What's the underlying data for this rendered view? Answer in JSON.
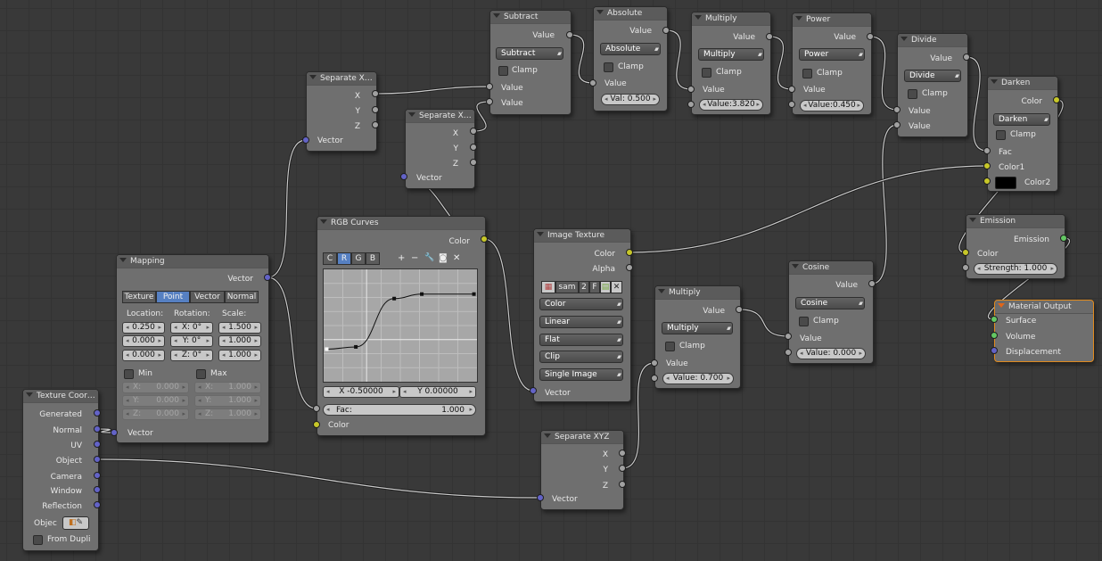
{
  "colors": {
    "canvas": "#393939",
    "node_body": "#6f6f6f",
    "socket_value": "#a1a1a1",
    "socket_color": "#c7c729",
    "socket_vector": "#6363c7",
    "socket_shader": "#63c763",
    "active_outline": "#e08a1e",
    "toggle_on": "#5680c2"
  },
  "texcoord": {
    "title": "Texture Coor…",
    "outputs": [
      "Generated",
      "Normal",
      "UV",
      "Object",
      "Camera",
      "Window",
      "Reflection"
    ],
    "object_label": "Objec",
    "from_dupli": "From Dupli"
  },
  "mapping": {
    "title": "Mapping",
    "out": "Vector",
    "tabs": [
      "Texture",
      "Point",
      "Vector",
      "Normal"
    ],
    "active_tab": "Point",
    "heads": [
      "Location:",
      "Rotation:",
      "Scale:"
    ],
    "loc": [
      "0.250",
      "0.000",
      "0.000"
    ],
    "rot": [
      "X:  0°",
      "Y:  0°",
      "Z:  0°"
    ],
    "scale": [
      "1.500",
      "1.000",
      "1.000"
    ],
    "min_label": "Min",
    "max_label": "Max",
    "min_vals": [
      "X:",
      "0.000",
      "Y:",
      "0.000",
      "Z:",
      "0.000"
    ],
    "max_vals": [
      "X:",
      "1.000",
      "Y:",
      "1.000",
      "Z:",
      "1.000"
    ],
    "in": "Vector"
  },
  "sep1": {
    "title": "Separate X…",
    "outs": [
      "X",
      "Y",
      "Z"
    ],
    "in": "Vector"
  },
  "sep2": {
    "title": "Separate X…",
    "outs": [
      "X",
      "Y",
      "Z"
    ],
    "in": "Vector"
  },
  "sep3": {
    "title": "Separate XYZ",
    "outs": [
      "X",
      "Y",
      "Z"
    ],
    "in": "Vector"
  },
  "curves": {
    "title": "RGB Curves",
    "out": "Color",
    "channels": [
      "C",
      "R",
      "G",
      "B"
    ],
    "active_channel": "R",
    "tool_icons": [
      "plus-icon",
      "minus-icon",
      "wrench-icon",
      "clip-icon",
      "close-icon"
    ],
    "tools": [
      "+",
      "−",
      "🔧",
      "◙",
      "✕"
    ],
    "x": "X -0.50000",
    "y": "Y 0.00000",
    "fac_label": "Fac:",
    "fac": "1.000",
    "in": "Color",
    "points": [
      [
        0.02,
        0.29
      ],
      [
        0.21,
        0.31
      ],
      [
        0.46,
        0.74
      ],
      [
        0.64,
        0.78
      ],
      [
        0.98,
        0.78
      ]
    ]
  },
  "subtract": {
    "title": "Subtract",
    "out": "Value",
    "op": "Subtract",
    "clamp": "Clamp",
    "ins": [
      "Value",
      "Value"
    ]
  },
  "absolute": {
    "title": "Absolute",
    "out": "Value",
    "op": "Absolute",
    "clamp": "Clamp",
    "in": "Value",
    "field": "Val: 0.500"
  },
  "multiply1": {
    "title": "Multiply",
    "out": "Value",
    "op": "Multiply",
    "clamp": "Clamp",
    "in": "Value",
    "field": "Value:3.820"
  },
  "power": {
    "title": "Power",
    "out": "Value",
    "op": "Power",
    "clamp": "Clamp",
    "in": "Value",
    "field": "Value:0.450"
  },
  "divide": {
    "title": "Divide",
    "out": "Value",
    "op": "Divide",
    "clamp": "Clamp",
    "ins": [
      "Value",
      "Value"
    ]
  },
  "darken": {
    "title": "Darken",
    "out": "Color",
    "op": "Darken",
    "clamp": "Clamp",
    "fac": "Fac",
    "c1": "Color1",
    "c2": "Color2",
    "c2_swatch": "#000000"
  },
  "emission": {
    "title": "Emission",
    "out": "Emission",
    "color": "Color",
    "strength": "Strength:      1.000"
  },
  "matout": {
    "title": "Material Output",
    "ins": [
      "Surface",
      "Volume",
      "Displacement"
    ]
  },
  "imgtex": {
    "title": "Image Texture",
    "outs": [
      "Color",
      "Alpha"
    ],
    "image": "sam",
    "users": "2",
    "fake": "F",
    "dropdowns": [
      "Color",
      "Linear",
      "Flat",
      "Clip",
      "Single Image"
    ],
    "in": "Vector"
  },
  "multiply2": {
    "title": "Multiply",
    "out": "Value",
    "op": "Multiply",
    "clamp": "Clamp",
    "in": "Value",
    "field": "Value:   0.700"
  },
  "cosine": {
    "title": "Cosine",
    "out": "Value",
    "op": "Cosine",
    "clamp": "Clamp",
    "in": "Value",
    "field": "Value:  0.000"
  }
}
